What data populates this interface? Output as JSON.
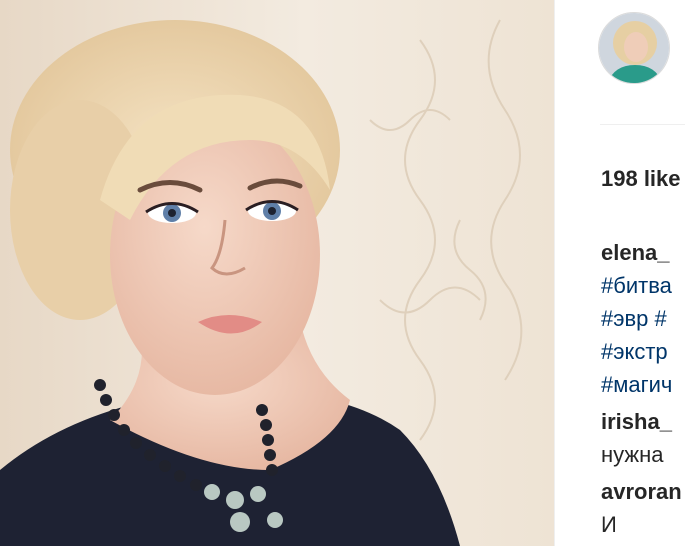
{
  "post": {
    "likes": "198 like",
    "comments": [
      {
        "user": "elena_",
        "hashtags": [
          "#битва",
          "#эвр #",
          "#экстр",
          "#магич"
        ]
      },
      {
        "user": "irisha_",
        "text": "нужна"
      },
      {
        "user": "avroran",
        "text": "И"
      }
    ]
  },
  "colors": {
    "username": "#262626",
    "hashtag": "#003569",
    "divider": "#efefef"
  }
}
